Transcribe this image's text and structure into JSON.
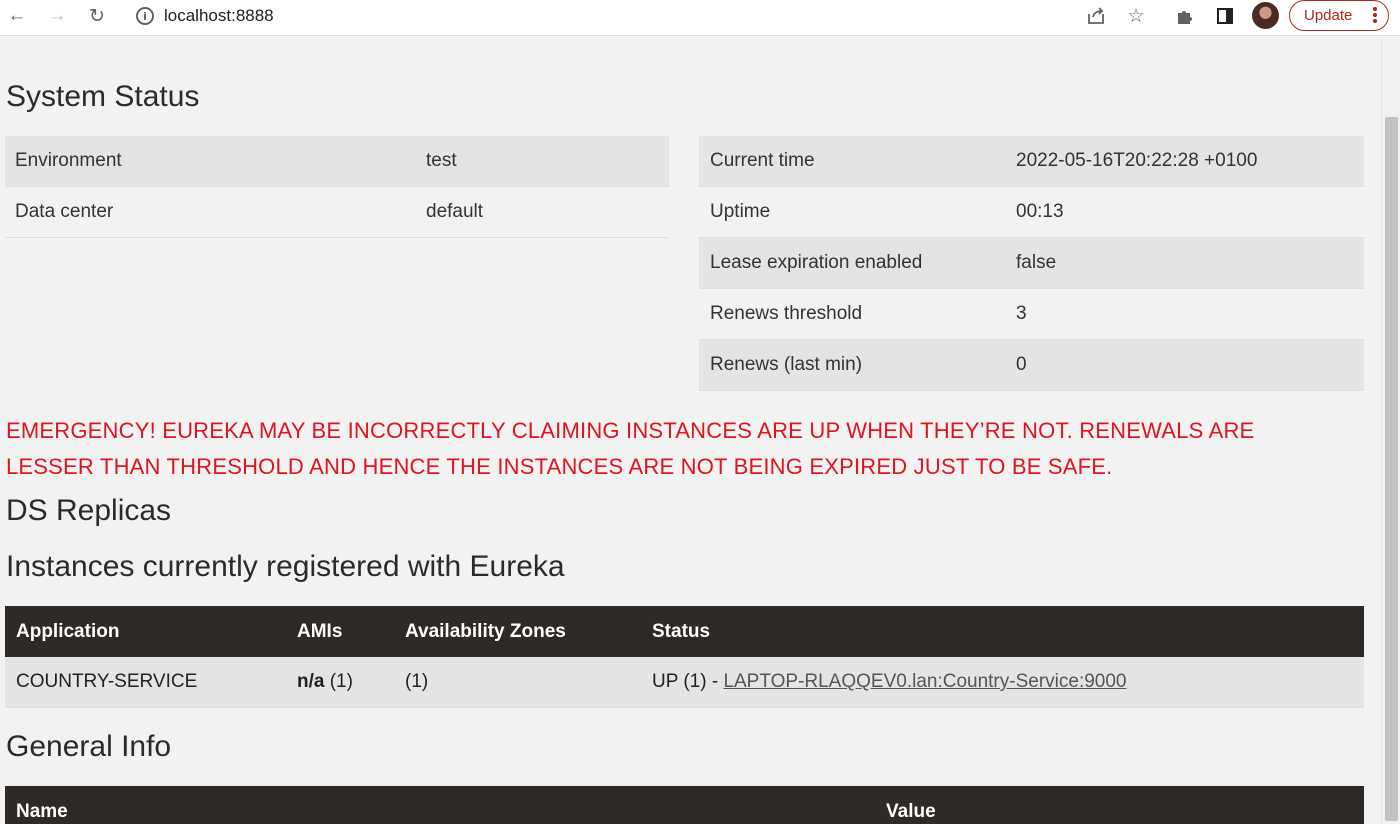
{
  "browser": {
    "url": "localhost:8888",
    "update_label": "Update"
  },
  "system_status": {
    "title": "System Status",
    "left": [
      {
        "label": "Environment",
        "value": "test"
      },
      {
        "label": "Data center",
        "value": "default"
      }
    ],
    "right": [
      {
        "label": "Current time",
        "value": "2022-05-16T20:22:28 +0100"
      },
      {
        "label": "Uptime",
        "value": "00:13"
      },
      {
        "label": "Lease expiration enabled",
        "value": "false"
      },
      {
        "label": "Renews threshold",
        "value": "3"
      },
      {
        "label": "Renews (last min)",
        "value": "0"
      }
    ]
  },
  "emergency": {
    "text": "EMERGENCY! EUREKA MAY BE INCORRECTLY CLAIMING INSTANCES ARE UP WHEN THEY’RE NOT. RENEWALS ARE LESSER THAN THRESHOLD AND HENCE THE INSTANCES ARE NOT BEING EXPIRED JUST TO BE SAFE."
  },
  "ds_replicas": {
    "title": "DS Replicas"
  },
  "instances": {
    "title": "Instances currently registered with Eureka",
    "headers": [
      "Application",
      "AMIs",
      "Availability Zones",
      "Status"
    ],
    "rows": [
      {
        "application": "COUNTRY-SERVICE",
        "amis_bold": "n/a",
        "amis_count": " (1)",
        "zones": "(1)",
        "status_prefix": "UP (1) - ",
        "status_link": "LAPTOP-RLAQQEV0.lan:Country-Service:9000"
      }
    ]
  },
  "general_info": {
    "title": "General Info",
    "headers": [
      "Name",
      "Value"
    ]
  },
  "colors": {
    "emergency_red": "#e0141e",
    "table_header_bg": "#2d2a27",
    "row_shade": "#e4e4e4",
    "update_accent": "#b3261e"
  }
}
